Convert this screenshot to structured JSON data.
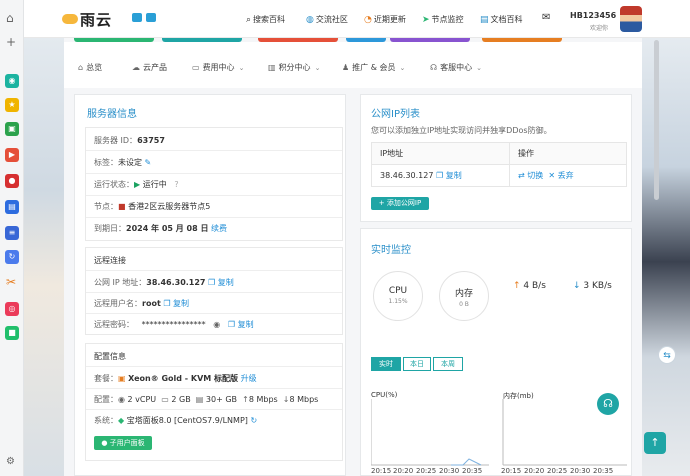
{
  "header": {
    "logo_text": "雨云",
    "nav": [
      {
        "label": "搜索百科",
        "icon": "search-icon"
      },
      {
        "label": "交流社区",
        "icon": "chat-icon"
      },
      {
        "label": "近期更新",
        "icon": "update-icon"
      },
      {
        "label": "节点监控",
        "icon": "send-icon"
      },
      {
        "label": "文档百科",
        "icon": "doc-icon"
      }
    ],
    "user_name": "HB123456",
    "user_greeting": "欢迎你"
  },
  "tabs": [
    {
      "label": "总览",
      "icon": "home-icon"
    },
    {
      "label": "云产品",
      "icon": "cloud-icon"
    },
    {
      "label": "费用中心",
      "icon": "money-icon"
    },
    {
      "label": "积分中心",
      "icon": "points-icon"
    },
    {
      "label": "推广 & 会员",
      "icon": "users-icon"
    },
    {
      "label": "客服中心",
      "icon": "headset-icon"
    }
  ],
  "server_info": {
    "title": "服务器信息",
    "server_id_label": "服务器 ID：",
    "server_id": "63757",
    "tag_label": "标签：",
    "tag_value": "未设定",
    "status_label": "运行状态：",
    "status_value": "运行中",
    "node_label": "节点：",
    "node_value": "香港2区云服务器节点5",
    "expire_label": "到期日：",
    "expire_value": "2024 年 05 月 08 日",
    "renew_label": "续费"
  },
  "remote": {
    "title": "远程连接",
    "ip_label": "公网 IP 地址：",
    "ip_value": "38.46.30.127",
    "copy_label": "复制",
    "user_label": "远程用户名：",
    "user_value": "root",
    "pwd_label": "远程密码：",
    "pwd_value": "****************"
  },
  "config": {
    "title": "配置信息",
    "plan_label": "套餐：",
    "plan_value": "Xeon® Gold - KVM 标配版",
    "upgrade_label": "升级",
    "spec_label": "配置：",
    "cpu": "2 vCPU",
    "ram": "2 GB",
    "disk": "30+ GB",
    "up": "8 Mbps",
    "down": "8 Mbps",
    "os_label": "系统：",
    "os_value": "宝塔面板8.0 [CentOS7.9/LNMP]",
    "sub_user_button": "子用户面板"
  },
  "ip_list": {
    "title": "公网IP列表",
    "desc": "您可以添加独立IP地址实现访问并独享DDos防御。",
    "col_ip": "IP地址",
    "col_action": "操作",
    "rows": [
      {
        "ip": "38.46.30.127",
        "copy": "复制",
        "switch": "切换",
        "delete": "丢弃"
      }
    ],
    "add_button": "+ 添加公网IP"
  },
  "monitor": {
    "title": "实时监控",
    "cpu_label": "CPU",
    "cpu_value": "1.15%",
    "mem_label": "内存",
    "mem_value": "0 B",
    "net_up": "4 B/s",
    "net_down": "3 KB/s",
    "ranges": [
      "实时",
      "本日",
      "本周"
    ],
    "cpu_chart_label": "CPU(%)",
    "mem_chart_label": "内存(mb)",
    "x_ticks": [
      "20:15",
      "20:20",
      "20:25",
      "20:30",
      "20:35"
    ]
  },
  "colors": {
    "accent": "#2a8fc9",
    "green": "#2bb673",
    "teal": "#1fa5a5"
  }
}
